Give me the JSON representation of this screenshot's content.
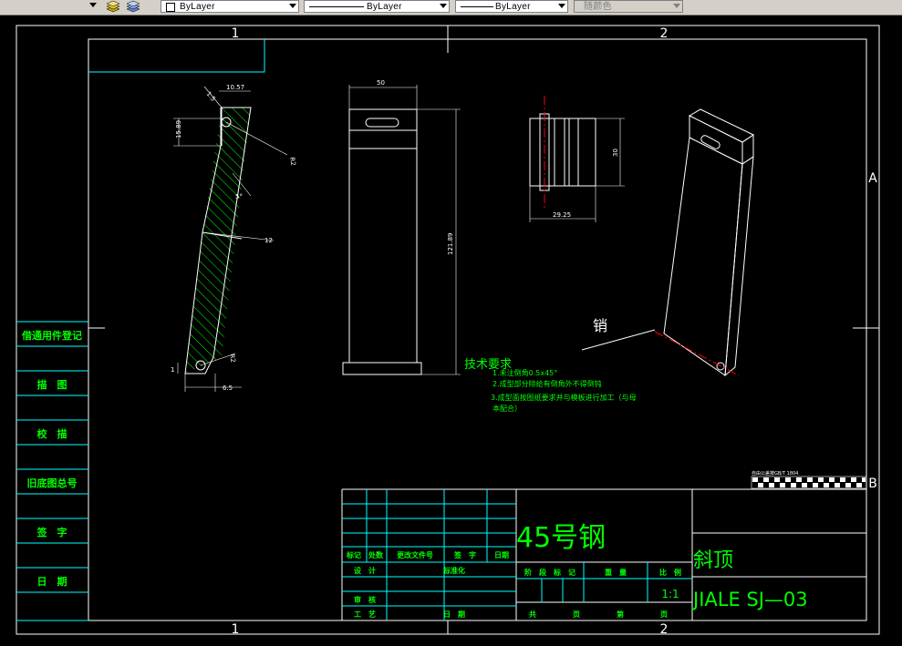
{
  "toolbar": {
    "layer_color_value": "ByLayer",
    "linetype_value": "ByLayer",
    "lineweight_value": "ByLayer",
    "plotstyle_value": "随颜色"
  },
  "border": {
    "zone_top_1": "1",
    "zone_top_2": "2",
    "zone_bottom_1": "1",
    "zone_bottom_2": "2",
    "zone_right_a": "A",
    "zone_right_b": "B"
  },
  "left_strip": {
    "labels": [
      "借通用件登记",
      "描　图",
      "校　描",
      "旧底图总号",
      "签　字",
      "日　期"
    ]
  },
  "dimensions": {
    "d1": "1.5",
    "d2": "10.57",
    "d3": "15.89",
    "d4": "R2",
    "d5": "5°",
    "d6": "12",
    "d7": "R2",
    "d8": "1",
    "d9": "6.5",
    "d10": "50",
    "d11": "121.89",
    "d12": "30",
    "d13": "29.25"
  },
  "annotation_pin": "销",
  "tech_req": {
    "title": "技术要求",
    "items": [
      "1.未注倒角0.5x45°",
      "2.成型部分除给有倒角外不得倒钝",
      "3.成型面按图纸要求并与模板进行加工（与母",
      "本配合）"
    ]
  },
  "stamp_text": "自由公差按GB/T 1804",
  "title_block": {
    "material": "45号钢",
    "part_name": "斜顶",
    "drawing_no": "JIALE SJ—03",
    "scale": "1:1",
    "h_mark": "标记",
    "h_count": "处数",
    "h_changedoc": "更改文件号",
    "h_sign": "签　字",
    "h_date": "日期",
    "h_design": "设　计",
    "h_std": "标准化",
    "h_check": "审　核",
    "h_process": "工　艺",
    "h_approve": "日　期",
    "h_stage": "阶　段　标　记",
    "h_weight": "重　量",
    "h_ratio": "比　例",
    "h_total": "共",
    "h_page": "页",
    "h_no": "第",
    "h_page2": "页"
  },
  "colors": {
    "line": "#ffffff",
    "cyan": "#00ffff",
    "green": "#00ff00",
    "red": "#ff0000",
    "background": "#000000"
  }
}
